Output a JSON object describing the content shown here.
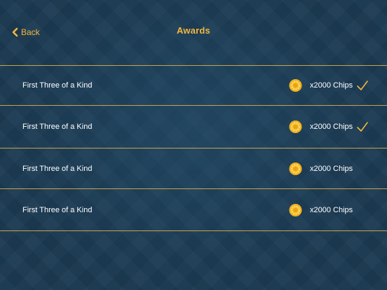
{
  "header": {
    "back_label": "Back",
    "title": "Awards"
  },
  "colors": {
    "accent": "#f3b63f",
    "divider": "#c9a24b",
    "background": "#1b3a52"
  },
  "awards": [
    {
      "title": "First Three of a Kind",
      "reward": "x2000 Chips",
      "claimed": true,
      "icon": "chip-icon"
    },
    {
      "title": "First Three of a Kind",
      "reward": "x2000 Chips",
      "claimed": true,
      "icon": "chip-icon"
    },
    {
      "title": "First Three of a Kind",
      "reward": "x2000 Chips",
      "claimed": false,
      "icon": "chip-icon"
    },
    {
      "title": "First Three of a Kind",
      "reward": "x2000 Chips",
      "claimed": false,
      "icon": "chip-icon"
    }
  ]
}
